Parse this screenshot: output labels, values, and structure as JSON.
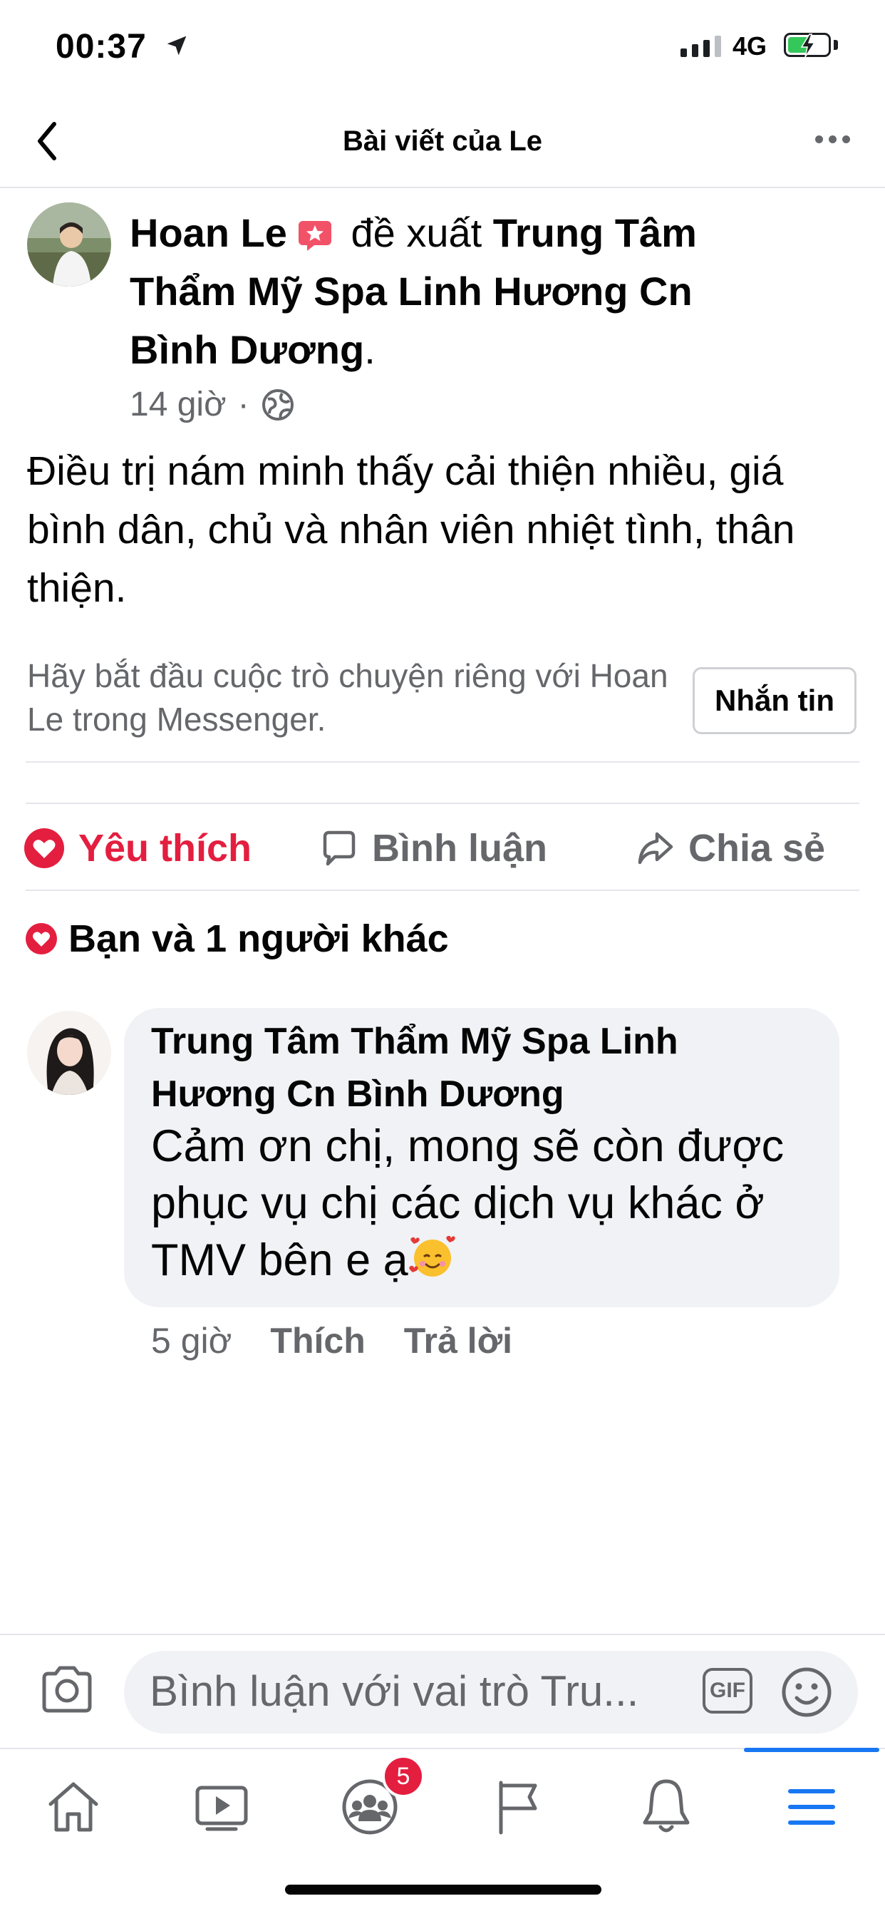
{
  "status_bar": {
    "time": "00:37",
    "network": "4G",
    "battery_color": "#34c759"
  },
  "header": {
    "title": "Bài viết của Le"
  },
  "post": {
    "author": "Hoan Le",
    "action": " đề xuất ",
    "page_name": "Trung Tâm Thẩm Mỹ Spa Linh Hương Cn Bình Dương",
    "period": ".",
    "time": "14 giờ",
    "dot": "·",
    "privacy_icon": "globe-icon",
    "text": "Điều trị nám minh thấy cải thiện nhiều, giá bình dân, chủ và nhân viên nhiệt tình, thân thiện.",
    "messenger_prompt": "Hãy bắt đầu cuộc trò chuyện riêng với Hoan Le trong Messenger.",
    "message_button": "Nhắn tin"
  },
  "actions": {
    "like": "Yêu thích",
    "comment": "Bình luận",
    "share": "Chia sẻ",
    "like_color": "#e41e3f"
  },
  "reactions": {
    "summary": "Bạn và 1 người khác"
  },
  "comment": {
    "author": "Trung Tâm Thẩm Mỹ Spa Linh Hương Cn Bình Dương",
    "text": "Cảm ơn chị, mong sẽ còn được phục vụ chị các dịch vụ khác ở TMV bên e ạ",
    "time": "5 giờ",
    "like": "Thích",
    "reply": "Trả lời"
  },
  "composer": {
    "placeholder": "Bình luận với vai trò Tru...",
    "gif_label": "GIF"
  },
  "tabbar": {
    "groups_badge": "5",
    "active_color": "#1877f2"
  }
}
